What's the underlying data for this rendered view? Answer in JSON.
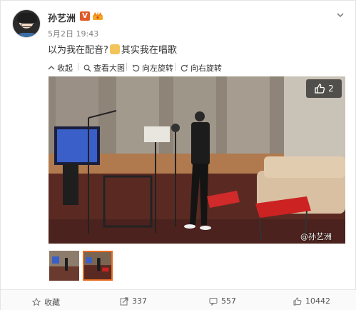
{
  "post": {
    "username": "孙艺洲",
    "vip_badge": "V",
    "time": "5月2日 19:43",
    "content_before": "以为我在配音?",
    "content_after": "其实我在唱歌"
  },
  "toolbar": {
    "collapse": "收起",
    "view_full": "查看大图",
    "rotate_left": "向左旋转",
    "rotate_right": "向右旋转"
  },
  "photo": {
    "like_count": "2",
    "watermark": "@孙艺洲"
  },
  "actions": {
    "favorite": "收藏",
    "repost": "337",
    "comment": "557",
    "like": "10442"
  },
  "colors": {
    "accent": "#e86b1f",
    "text": "#333333",
    "muted": "#808080"
  },
  "icons": [
    "chevron-down-icon",
    "collapse-icon",
    "zoom-icon",
    "rotate-left-icon",
    "rotate-right-icon",
    "thumbs-up-icon",
    "star-icon",
    "repost-icon",
    "comment-icon",
    "like-icon"
  ]
}
